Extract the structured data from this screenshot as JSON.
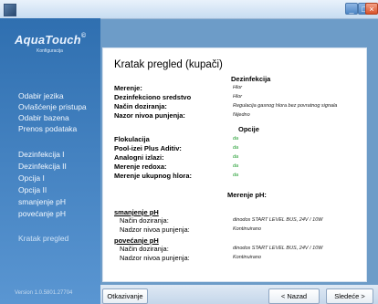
{
  "window": {
    "minimize": "_",
    "maximize": "□",
    "close": "×"
  },
  "sidebar": {
    "logo": "AquaTouch",
    "logo_sub": "Konfiguracija",
    "items": [
      {
        "label": "Odabir jezika"
      },
      {
        "label": "Ovlašćenje pristupa"
      },
      {
        "label": "Odabir bazena"
      },
      {
        "label": "Prenos podataka"
      },
      {
        "label": "Dezinfekcija I"
      },
      {
        "label": "Dezinfekcija II"
      },
      {
        "label": "Opcija I"
      },
      {
        "label": "Opcija II"
      },
      {
        "label": "smanjenje pH"
      },
      {
        "label": "povećanje pH"
      },
      {
        "label": "Kratak pregled"
      }
    ],
    "version": "Version 1.0.5801.27704"
  },
  "panel": {
    "title": "Kratak pregled (kupači)",
    "dezinfekcija": {
      "heading": "Dezinfekcija",
      "rows": [
        {
          "label": "Merenje:",
          "value": "Hlor"
        },
        {
          "label": "Dezinfekciono sredstvo",
          "value": "Hlor"
        },
        {
          "label": "Način doziranja:",
          "value": "Regulacija gasnog hlora bez povratnog signala"
        },
        {
          "label": "Nazor nivoa punjenja:",
          "value": "Nijedno"
        }
      ]
    },
    "opcije": {
      "heading": "Opcije",
      "rows": [
        {
          "label": "Flokulacija",
          "value": "da"
        },
        {
          "label": "Pool-izei Plus Aditiv:",
          "value": "da"
        },
        {
          "label": "Analogni izlazi:",
          "value": "da"
        },
        {
          "label": "Merenje redoxa:",
          "value": "da"
        },
        {
          "label": "Merenje ukupnog hlora:",
          "value": "da"
        }
      ]
    },
    "ph": {
      "heading": "Merenje pH:",
      "smanjenje": {
        "heading": "smanjenje pH",
        "rows": [
          {
            "label": "Način doziranja:",
            "value": "dinodos START LEVEL BUS, 24V / 10W"
          },
          {
            "label": "Nadzor nivoa punjenja:",
            "value": "Kontinuirano"
          }
        ]
      },
      "povecanje": {
        "heading": "povećanje pH",
        "rows": [
          {
            "label": "Način doziranja:",
            "value": "dinodos START LEVEL BUS, 24V / 10W"
          },
          {
            "label": "Nadzor nivoa punjenja:",
            "value": "Kontinuirano"
          }
        ]
      }
    }
  },
  "buttons": {
    "cancel": "Otkazivanje",
    "back": "< Nazad",
    "next": "Sledeće >"
  },
  "colors": {
    "sidebar": "#2f6fb0",
    "value_green": "#1a9a2a"
  }
}
